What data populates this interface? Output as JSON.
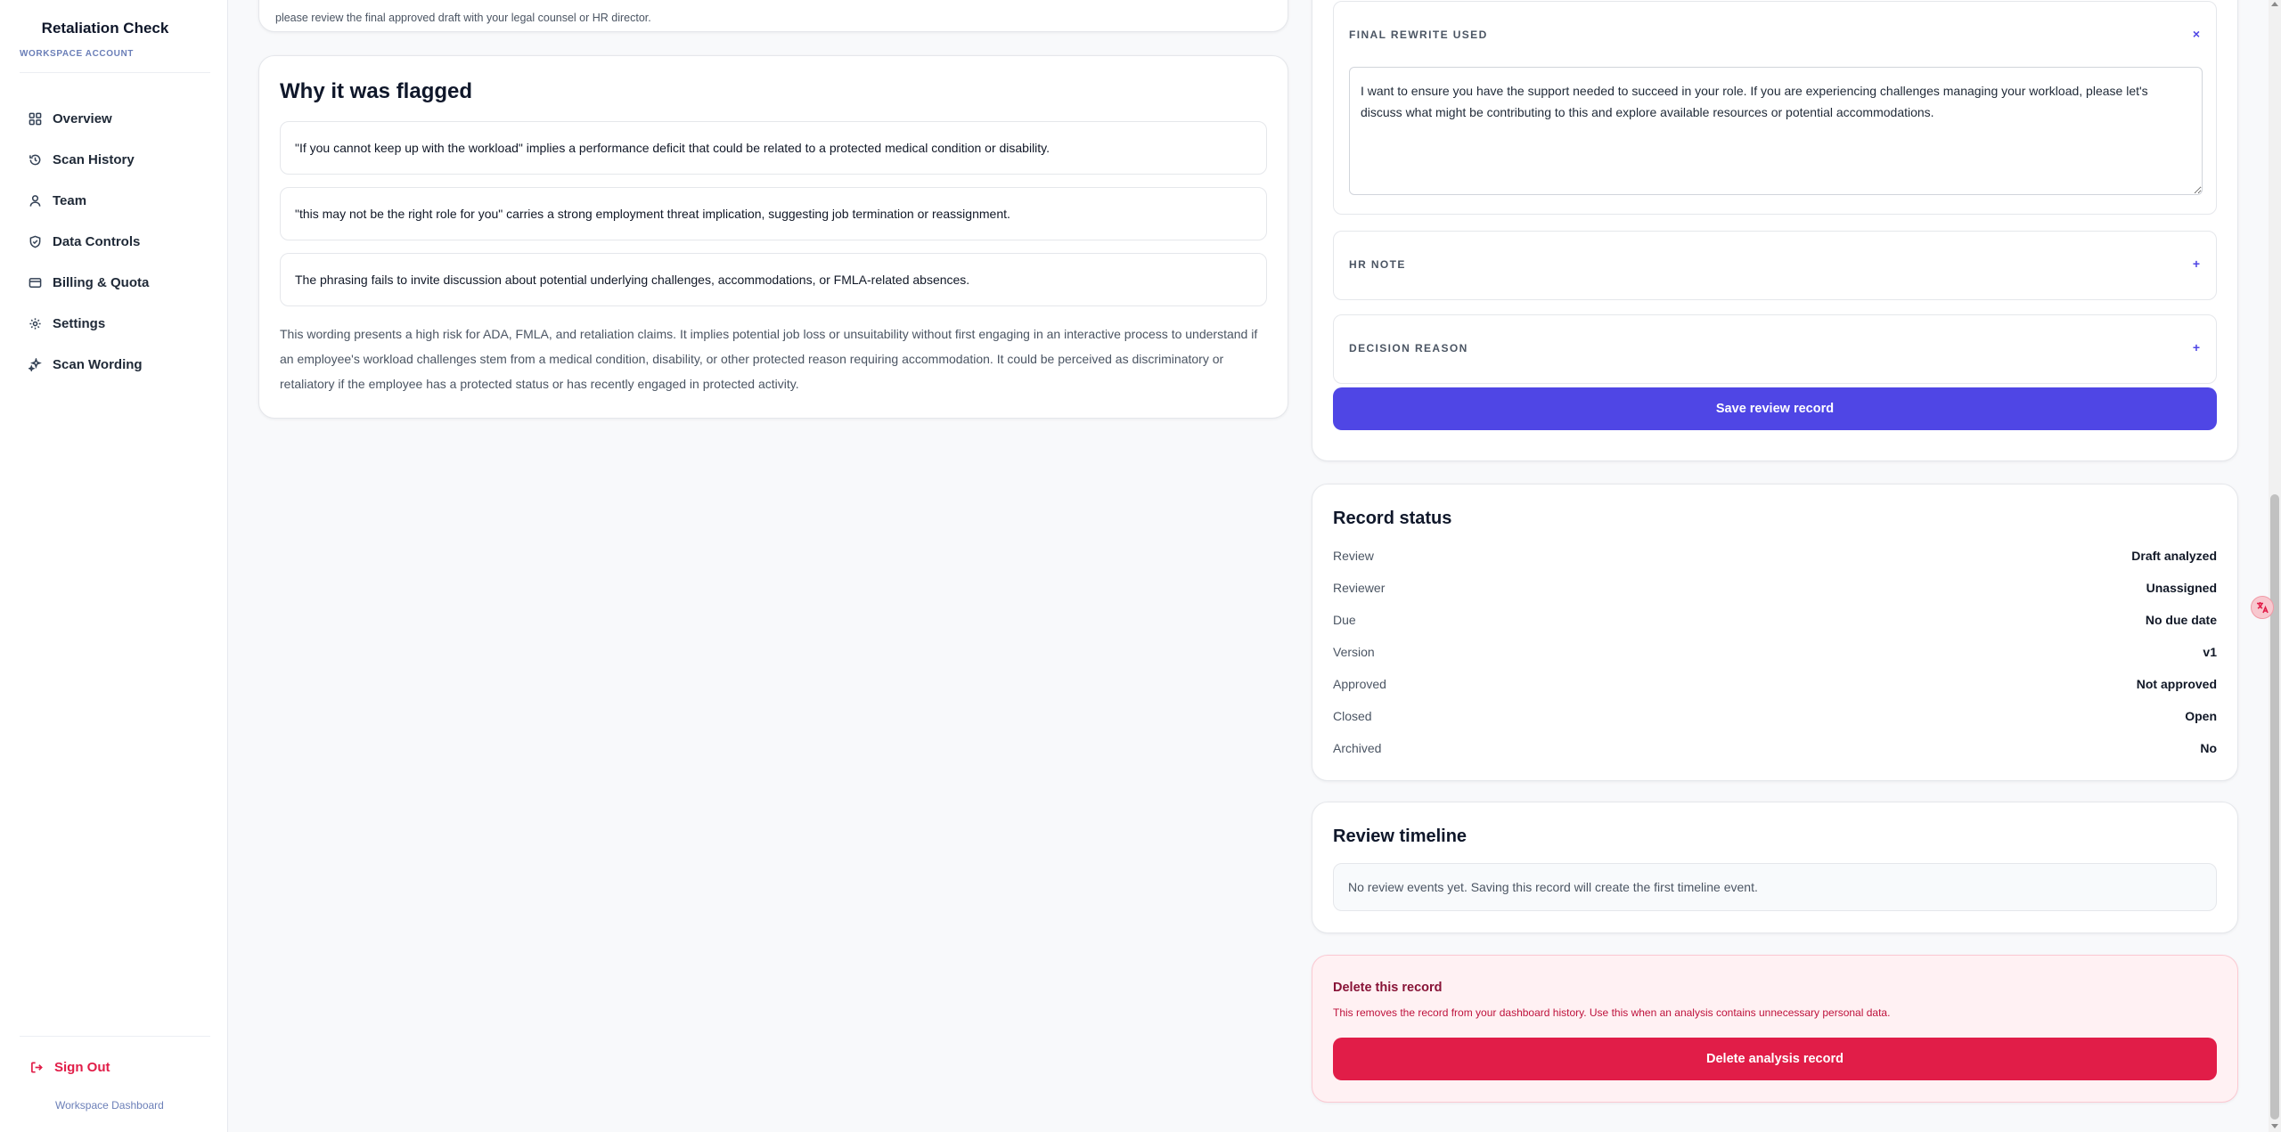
{
  "sidebar": {
    "brand": "Retaliation Check",
    "account_label": "WORKSPACE ACCOUNT",
    "items": [
      {
        "label": "Overview",
        "icon": "grid-icon"
      },
      {
        "label": "Scan History",
        "icon": "history-icon"
      },
      {
        "label": "Team",
        "icon": "user-icon"
      },
      {
        "label": "Data Controls",
        "icon": "shield-icon"
      },
      {
        "label": "Billing & Quota",
        "icon": "credit-card-icon"
      },
      {
        "label": "Settings",
        "icon": "gear-icon"
      },
      {
        "label": "Scan Wording",
        "icon": "sparkles-icon"
      }
    ],
    "sign_out": "Sign Out",
    "footer": "Workspace Dashboard"
  },
  "top_card": {
    "text": "please review the final approved draft with your legal counsel or HR director."
  },
  "why_flagged": {
    "title": "Why it was flagged",
    "reasons": [
      "\"If you cannot keep up with the workload\" implies a performance deficit that could be related to a protected medical condition or disability.",
      "\"this may not be the right role for you\" carries a strong employment threat implication, suggesting job termination or reassignment.",
      "The phrasing fails to invite discussion about potential underlying challenges, accommodations, or FMLA-related absences."
    ],
    "summary": "This wording presents a high risk for ADA, FMLA, and retaliation claims. It implies potential job loss or unsuitability without first engaging in an interactive process to understand if an employee's workload challenges stem from a medical condition, disability, or other protected reason requiring accommodation. It could be perceived as discriminatory or retaliatory if the employee has a protected status or has recently engaged in protected activity."
  },
  "review_form": {
    "final_rewrite": {
      "label": "FINAL REWRITE USED",
      "toggle": "×",
      "value": "I want to ensure you have the support needed to succeed in your role. If you are experiencing challenges managing your workload, please let's discuss what might be contributing to this and explore available resources or potential accommodations."
    },
    "hr_note": {
      "label": "HR NOTE",
      "toggle": "+"
    },
    "decision_reason": {
      "label": "DECISION REASON",
      "toggle": "+"
    },
    "save_label": "Save review record"
  },
  "record_status": {
    "title": "Record status",
    "rows": [
      {
        "key": "Review",
        "value": "Draft analyzed"
      },
      {
        "key": "Reviewer",
        "value": "Unassigned"
      },
      {
        "key": "Due",
        "value": "No due date"
      },
      {
        "key": "Version",
        "value": "v1"
      },
      {
        "key": "Approved",
        "value": "Not approved"
      },
      {
        "key": "Closed",
        "value": "Open"
      },
      {
        "key": "Archived",
        "value": "No"
      }
    ]
  },
  "timeline": {
    "title": "Review timeline",
    "empty": "No review events yet. Saving this record will create the first timeline event."
  },
  "delete": {
    "title": "Delete this record",
    "text": "This removes the record from your dashboard history. Use this when an analysis contains unnecessary personal data.",
    "button": "Delete analysis record"
  },
  "colors": {
    "primary": "#4f46e5",
    "danger": "#e11d48",
    "danger_bg": "#fff1f3"
  }
}
